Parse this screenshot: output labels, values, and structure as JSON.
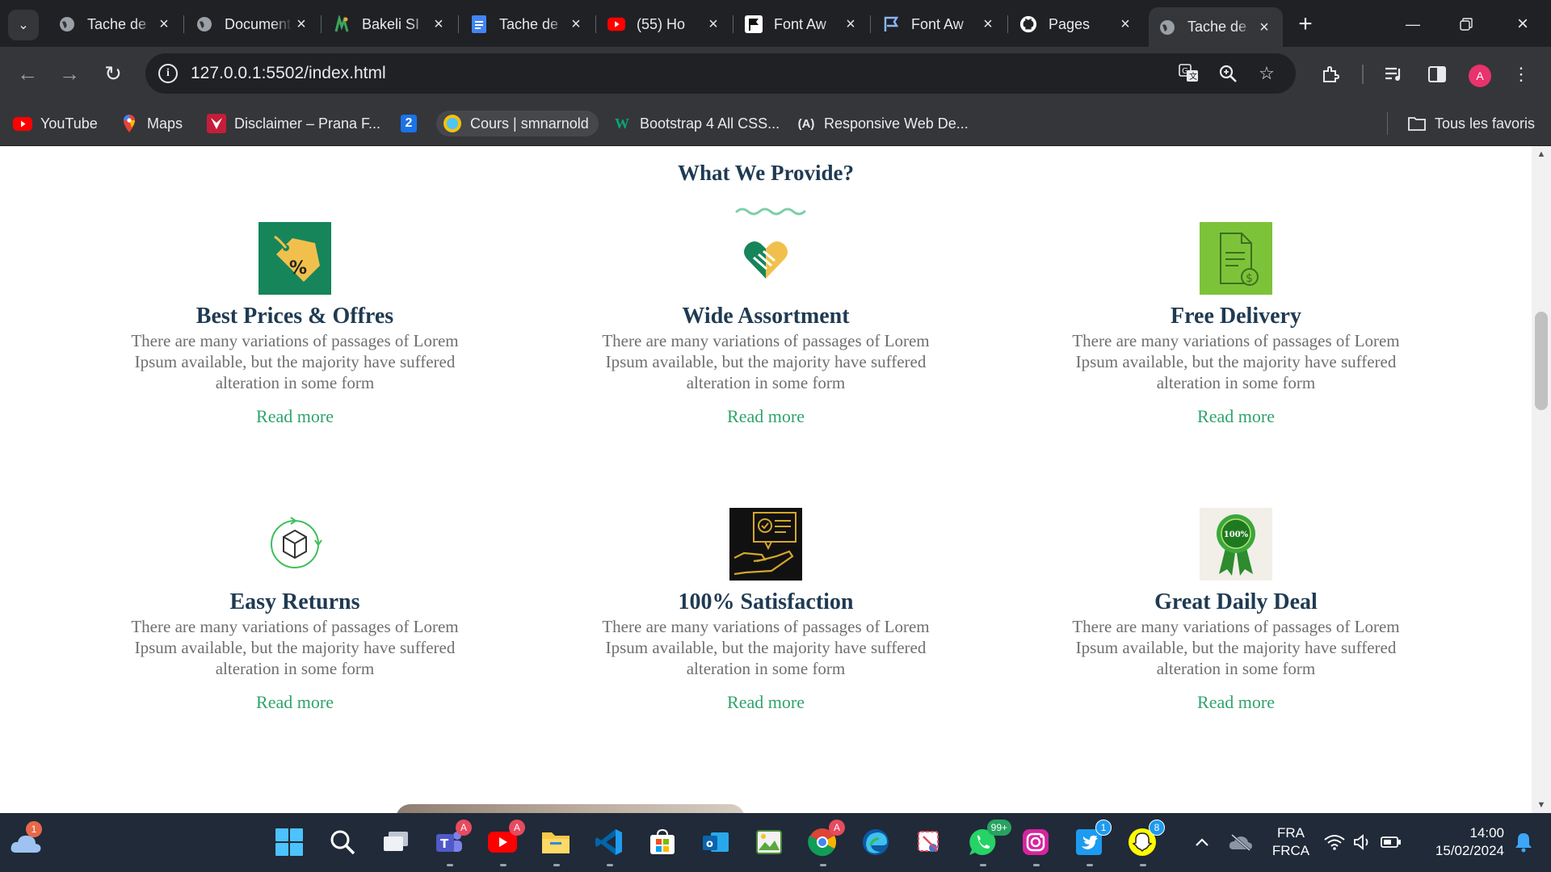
{
  "browser": {
    "tabs": [
      {
        "title": "Tache de",
        "icon": "globe-icon"
      },
      {
        "title": "Document",
        "icon": "globe-icon"
      },
      {
        "title": "Bakeli SI",
        "icon": "bakeli-icon"
      },
      {
        "title": "Tache de",
        "icon": "google-docs-icon"
      },
      {
        "title": "(55) Ho",
        "icon": "youtube-icon"
      },
      {
        "title": "Font Aw",
        "icon": "flag-icon"
      },
      {
        "title": "Font Aw",
        "icon": "flag-outline-icon"
      },
      {
        "title": "Pages",
        "icon": "github-icon"
      },
      {
        "title": "Tache de",
        "icon": "globe-icon",
        "active": true
      }
    ],
    "url": "127.0.0.1:5502/index.html",
    "avatar_letter": "A",
    "bookmarks": [
      {
        "label": "YouTube",
        "icon": "youtube-icon"
      },
      {
        "label": "Maps",
        "icon": "maps-pin-icon"
      },
      {
        "label": "Disclaimer – Prana F...",
        "icon": "prana-icon"
      },
      {
        "label": "",
        "icon": "number-2-icon",
        "glyph": "2"
      },
      {
        "label": "Cours | smnarnold",
        "icon": "course-icon"
      },
      {
        "label": "Bootstrap 4 All CSS...",
        "icon": "w3-icon",
        "glyph": "W"
      },
      {
        "label": "Responsive Web De...",
        "icon": "a-logo-icon",
        "glyph": "(A)"
      }
    ],
    "all_bookmarks_label": "Tous les favoris"
  },
  "page": {
    "section_title": "What We Provide?",
    "read_more": "Read more",
    "features": [
      {
        "title": "Best Prices & Offres",
        "text": "There are many variations of passages of Lorem Ipsum available, but the majority have suffered alteration in some form",
        "icon": "price-tag-icon"
      },
      {
        "title": "Wide Assortment",
        "text": "There are many variations of passages of Lorem Ipsum available, but the majority have suffered alteration in some form",
        "icon": "handshake-heart-icon"
      },
      {
        "title": "Free Delivery",
        "text": "There are many variations of passages of Lorem Ipsum available, but the majority have suffered alteration in some form",
        "icon": "invoice-dollar-icon"
      },
      {
        "title": "Easy Returns",
        "text": "There are many variations of passages of Lorem Ipsum available, but the majority have suffered alteration in some form",
        "icon": "box-return-icon"
      },
      {
        "title": "100% Satisfaction",
        "text": "There are many variations of passages of Lorem Ipsum available, but the majority have suffered alteration in some form",
        "icon": "satisfaction-hand-icon"
      },
      {
        "title": "Great Daily Deal",
        "text": "There are many variations of passages of Lorem Ipsum available, but the majority have suffered alteration in some form",
        "icon": "award-ribbon-icon",
        "badge_text": "100%"
      }
    ]
  },
  "taskbar": {
    "weather_badge": "1",
    "teams_badge": "A",
    "youtube_badge": "A",
    "chrome_badge": "A",
    "whatsapp_badge": "99+",
    "twitter_badge": "1",
    "snapchat_badge": "8",
    "language_line1": "FRA",
    "language_line2": "FRCA",
    "time": "14:00",
    "date": "15/02/2024"
  },
  "colors": {
    "title": "#1f3a52",
    "accent_green": "#2fa36b",
    "body_text": "#6f6f6f",
    "chrome_dark": "#202124",
    "chrome_toolbar": "#35363a"
  }
}
